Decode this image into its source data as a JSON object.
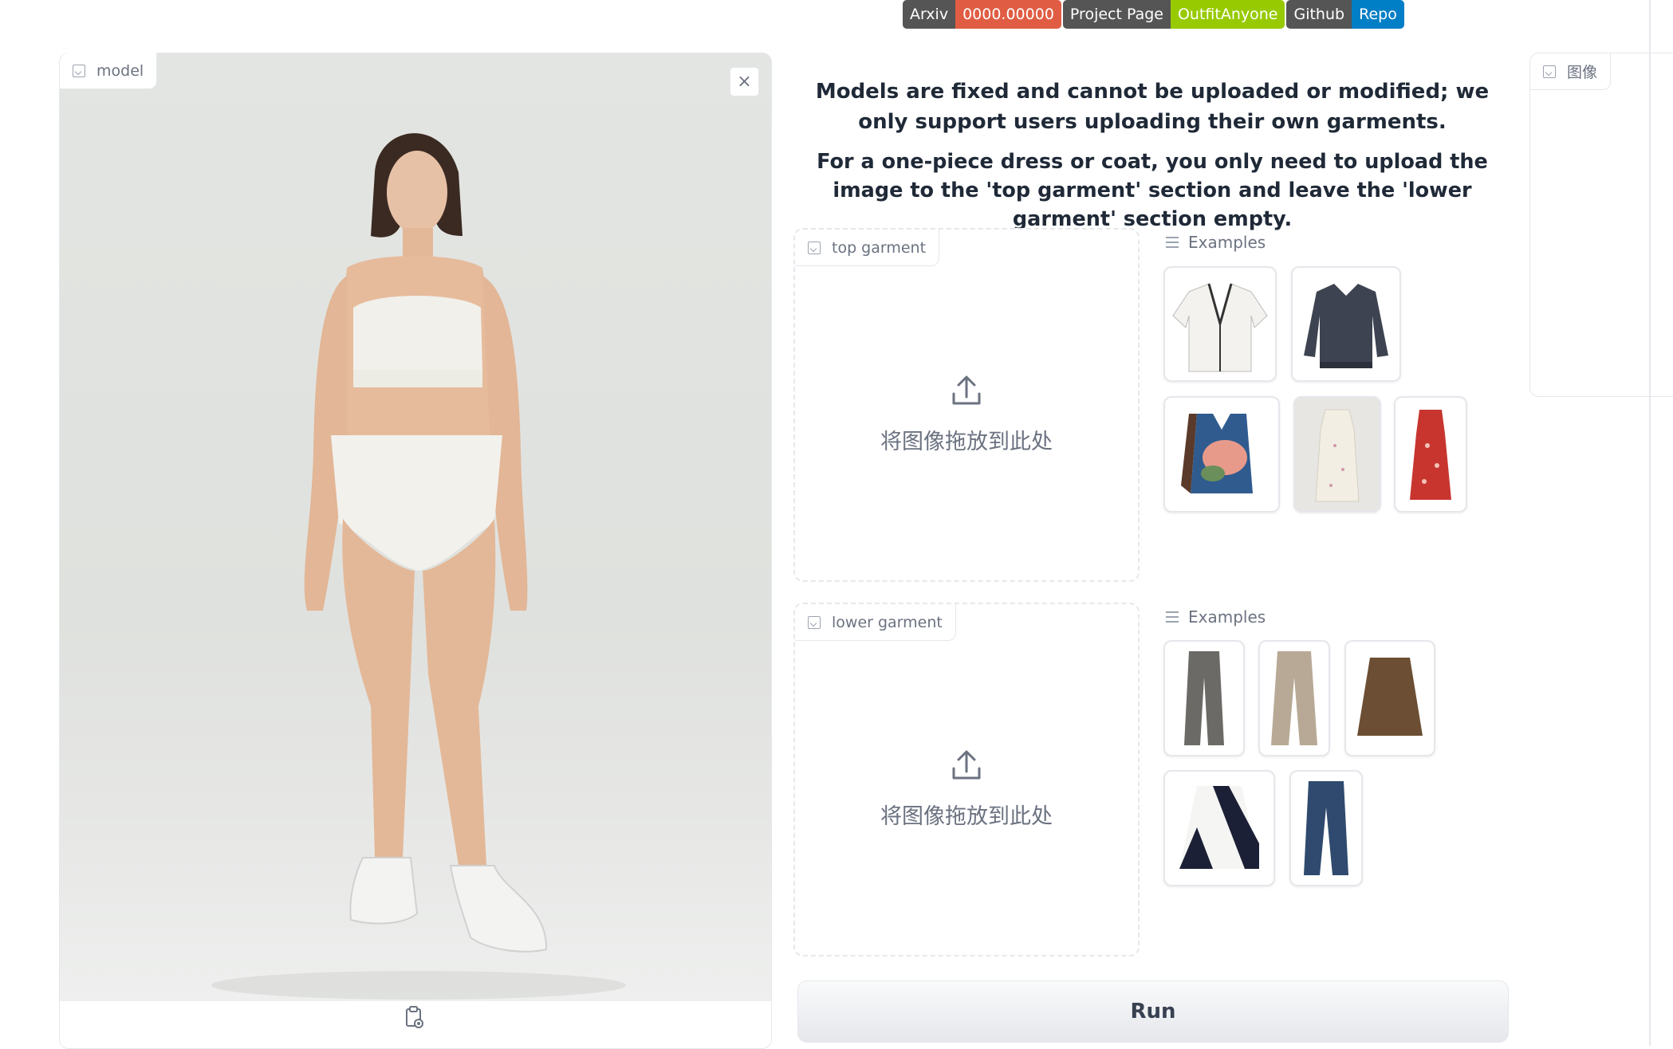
{
  "badges": [
    {
      "label": "Arxiv",
      "value": "0000.00000",
      "color": "#e05d44"
    },
    {
      "label": "Project Page",
      "value": "OutfitAnyone",
      "color": "#97ca00"
    },
    {
      "label": "Github",
      "value": "Repo",
      "color": "#007ec6"
    }
  ],
  "model_panel": {
    "label": "model",
    "close_icon": "×"
  },
  "info": {
    "line1": "Models are fixed and cannot be uploaded or modified; we only support users uploading their own garments.",
    "line2": "For a one-piece dress or coat, you only need to upload the image to the 'top garment' section and leave the 'lower garment' section empty."
  },
  "top_garment": {
    "label": "top garment",
    "drop_text": "将图像拖放到此处"
  },
  "lower_garment": {
    "label": "lower garment",
    "drop_text": "将图像拖放到此处"
  },
  "examples": {
    "top_label": "Examples",
    "lower_label": "Examples"
  },
  "output_panel": {
    "label": "图像"
  },
  "run_button": {
    "label": "Run"
  },
  "colors": {
    "accent_gray": "#e5e7eb",
    "muted_text": "#6b7280"
  }
}
